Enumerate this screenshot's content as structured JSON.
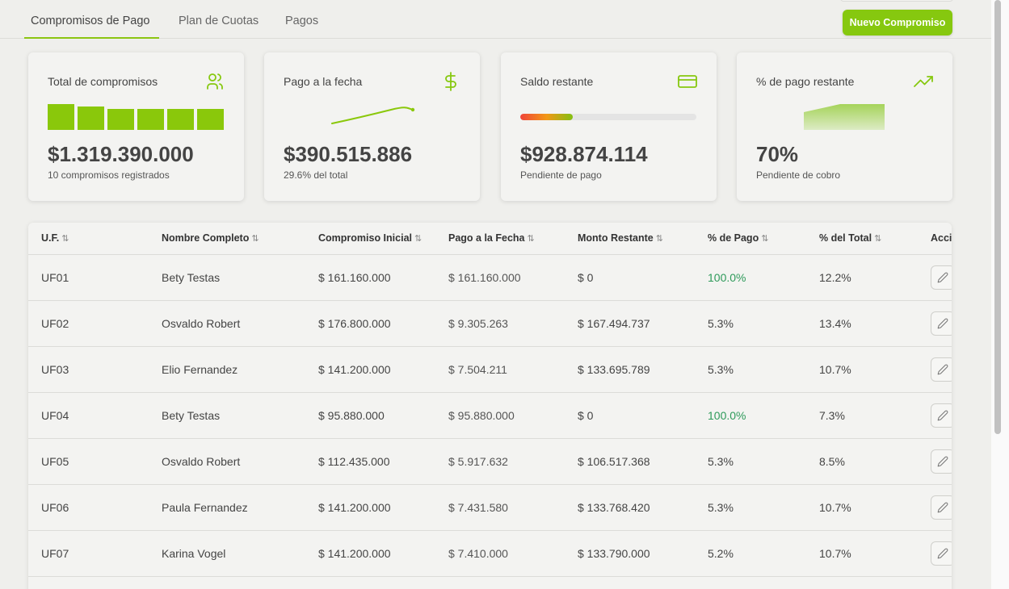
{
  "tabs": [
    {
      "label": "Compromisos de Pago",
      "active": true
    },
    {
      "label": "Plan de Cuotas",
      "active": false
    },
    {
      "label": "Pagos",
      "active": false
    }
  ],
  "new_button_label": "Nuevo Compromiso",
  "accent_color": "#86c80f",
  "cards": {
    "total": {
      "label": "Total de compromisos",
      "value": "$1.319.390.000",
      "sub": "10 compromisos registrados",
      "icon": "users-icon",
      "bar_levels": [
        1.0,
        0.9,
        0.8,
        0.8,
        0.8,
        0.8
      ]
    },
    "paid": {
      "label": "Pago a la fecha",
      "value": "$390.515.886",
      "sub": "29.6% del total",
      "icon": "dollar-icon"
    },
    "balance": {
      "label": "Saldo restante",
      "value": "$928.874.114",
      "sub": "Pendiente de pago",
      "icon": "credit-card-icon",
      "progress_fraction": 0.296
    },
    "percent": {
      "label": "% de pago restante",
      "value": "70%",
      "sub": "Pendiente de cobro",
      "icon": "trending-up-icon"
    }
  },
  "table": {
    "columns": [
      "U.F.",
      "Nombre Completo",
      "Compromiso Inicial",
      "Pago a la Fecha",
      "Monto Restante",
      "% de Pago",
      "% del Total",
      "Acci"
    ],
    "rows": [
      [
        "UF01",
        "Bety Testas",
        "$ 161.160.000",
        "$ 161.160.000",
        "$ 0",
        "100.0%",
        "12.2%"
      ],
      [
        "UF02",
        "Osvaldo Robert",
        "$ 176.800.000",
        "$ 9.305.263",
        "$ 167.494.737",
        "5.3%",
        "13.4%"
      ],
      [
        "UF03",
        "Elio Fernandez",
        "$ 141.200.000",
        "$ 7.504.211",
        "$ 133.695.789",
        "5.3%",
        "10.7%"
      ],
      [
        "UF04",
        "Bety Testas",
        "$ 95.880.000",
        "$ 95.880.000",
        "$ 0",
        "100.0%",
        "7.3%"
      ],
      [
        "UF05",
        "Osvaldo Robert",
        "$ 112.435.000",
        "$ 5.917.632",
        "$ 106.517.368",
        "5.3%",
        "8.5%"
      ],
      [
        "UF06",
        "Paula Fernandez",
        "$ 141.200.000",
        "$ 7.431.580",
        "$ 133.768.420",
        "5.3%",
        "10.7%"
      ],
      [
        "UF07",
        "Karina Vogel",
        "$ 141.200.000",
        "$ 7.410.000",
        "$ 133.790.000",
        "5.2%",
        "10.7%"
      ]
    ],
    "full_payment_color": "#2e9a5a"
  }
}
